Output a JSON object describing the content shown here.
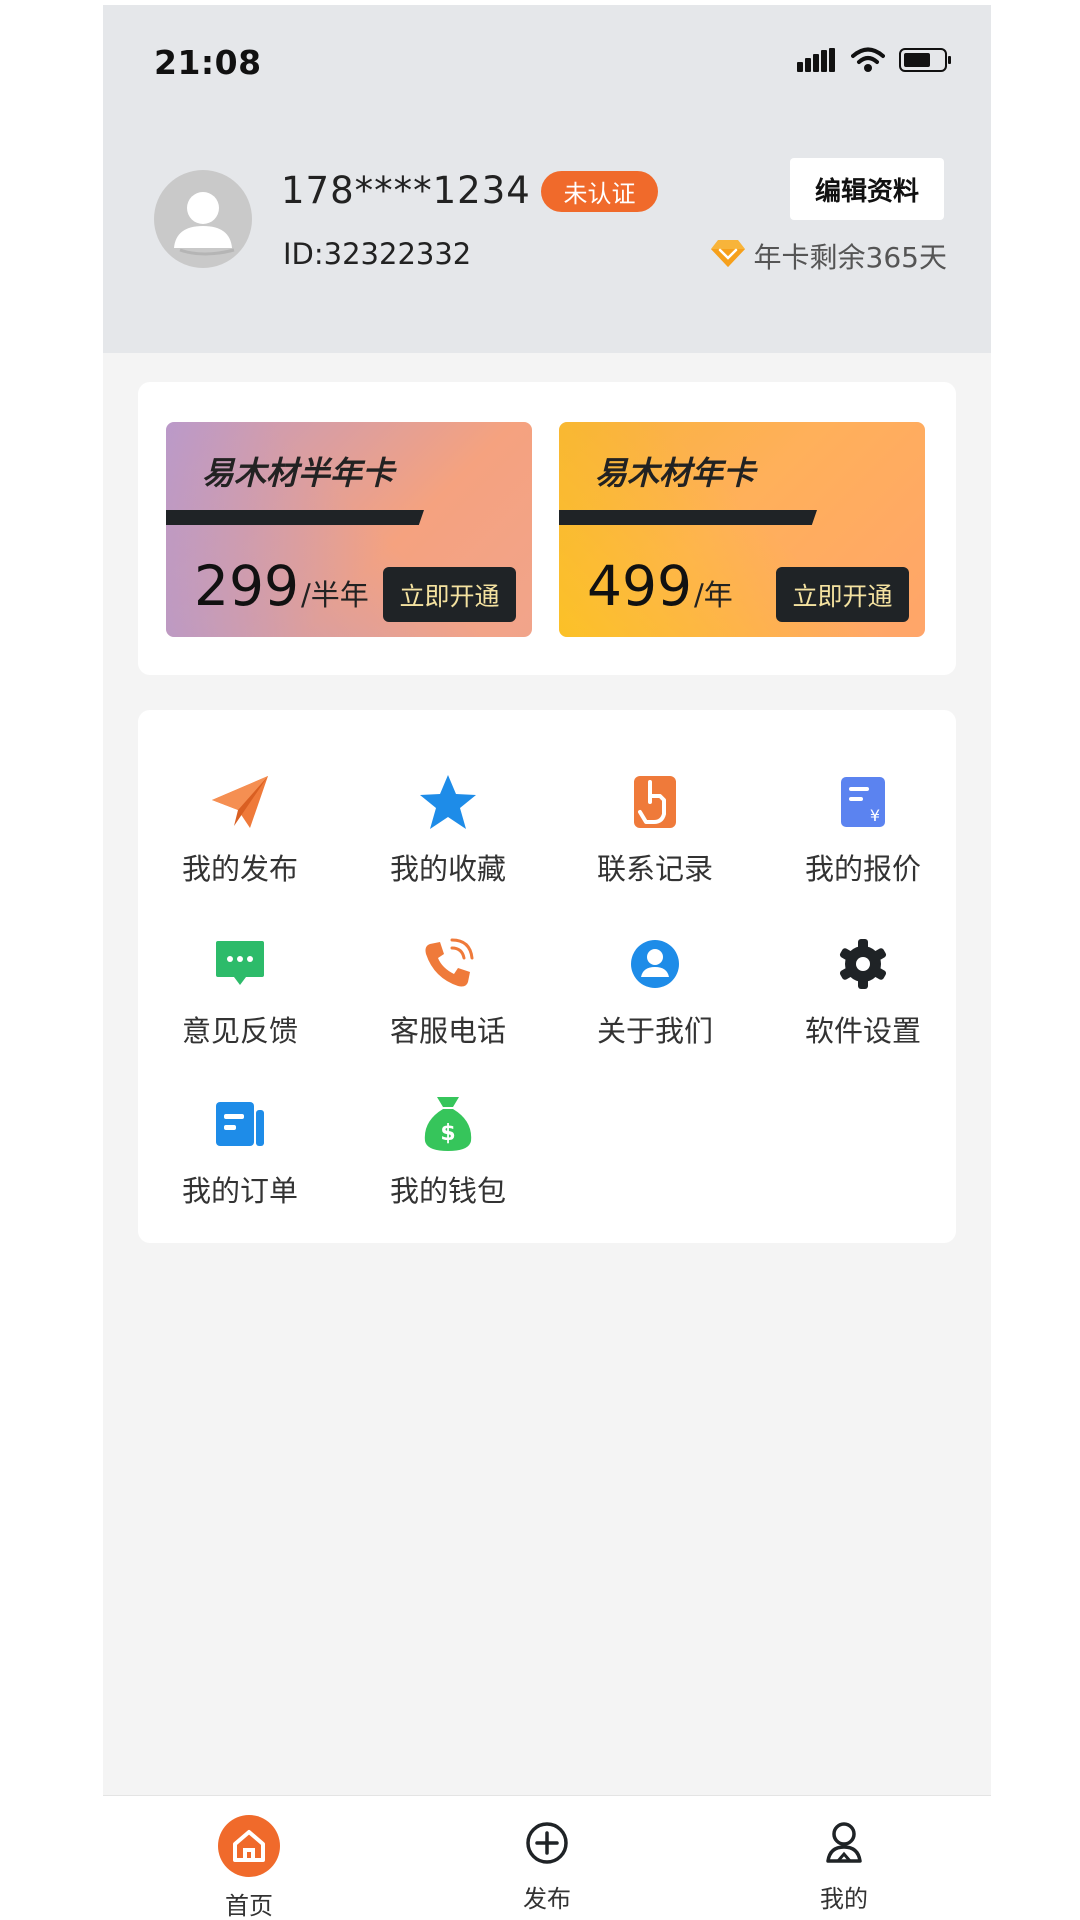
{
  "status_bar": {
    "time": "21:08"
  },
  "profile": {
    "phone": "178****1234",
    "auth_badge": "未认证",
    "id": "ID:32322332",
    "edit_label": "编辑资料",
    "vip_remain": "年卡剩余365天"
  },
  "cards": [
    {
      "title": "易木材半年卡",
      "price": "299",
      "unit": "/半年",
      "button": "立即开通"
    },
    {
      "title": "易木材年卡",
      "price": "499",
      "unit": "/年",
      "button": "立即开通"
    }
  ],
  "menu": [
    {
      "label": "我的发布",
      "icon": "paper-plane-icon",
      "color": "#ef7a3a"
    },
    {
      "label": "我的收藏",
      "icon": "star-icon",
      "color": "#1e8ce8"
    },
    {
      "label": "联系记录",
      "icon": "touch-hand-icon",
      "color": "#ef7a3a"
    },
    {
      "label": "我的报价",
      "icon": "quote-document-icon",
      "color": "#5b83f0"
    },
    {
      "label": "意见反馈",
      "icon": "chat-bubble-icon",
      "color": "#2dbb6a"
    },
    {
      "label": "客服电话",
      "icon": "phone-call-icon",
      "color": "#ef7a3a"
    },
    {
      "label": "关于我们",
      "icon": "user-circle-icon",
      "color": "#1e8ce8"
    },
    {
      "label": "软件设置",
      "icon": "gear-icon",
      "color": "#1f2326"
    },
    {
      "label": "我的订单",
      "icon": "order-list-icon",
      "color": "#1e8ce8"
    },
    {
      "label": "我的钱包",
      "icon": "money-bag-icon",
      "color": "#36c55b"
    }
  ],
  "tabbar": [
    {
      "label": "首页",
      "icon": "home-icon",
      "active": true
    },
    {
      "label": "发布",
      "icon": "plus-circle-icon",
      "active": false
    },
    {
      "label": "我的",
      "icon": "user-icon",
      "active": false
    }
  ],
  "colors": {
    "accent": "#f06a2b",
    "header_bg": "#e5e7ea",
    "page_bg": "#f4f4f4"
  }
}
